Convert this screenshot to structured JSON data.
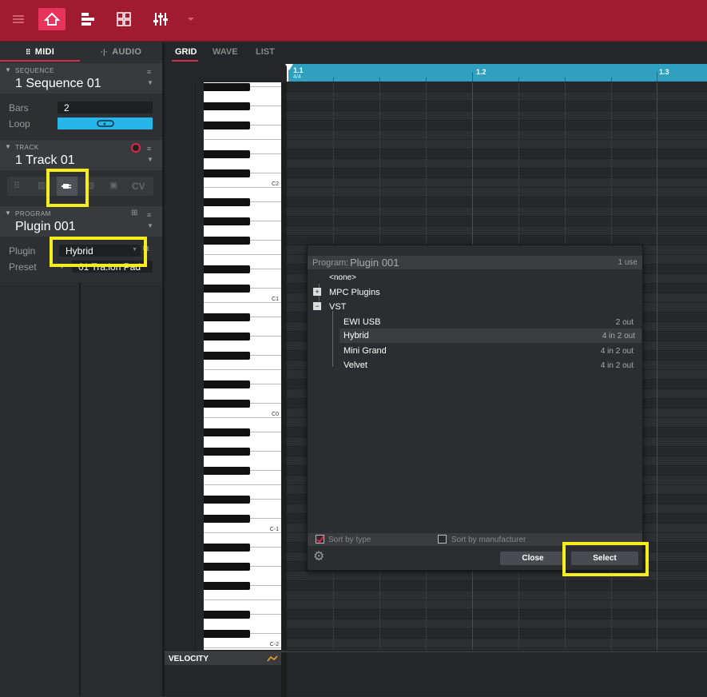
{
  "topbar": {
    "icons": [
      "menu-icon",
      "home-icon",
      "sequence-icon",
      "pads-icon",
      "mixer-icon",
      "dropdown-icon"
    ],
    "bg_color": "#a01a30",
    "active_color": "#e6345a"
  },
  "mode_tabs": {
    "midi": "MIDI",
    "audio": "AUDIO"
  },
  "sequence": {
    "label": "SEQUENCE",
    "title": "1 Sequence 01",
    "bars_label": "Bars",
    "bars_value": "2",
    "loop_label": "Loop"
  },
  "track": {
    "label": "TRACK",
    "title": "1 Track 01",
    "type_cv": "CV"
  },
  "program": {
    "label": "PROGRAM",
    "title": "Plugin 001",
    "plugin_label": "Plugin",
    "plugin_value": "Hybrid",
    "preset_label": "Preset",
    "preset_value": "01 Tra.ion Pad"
  },
  "view_tabs": {
    "grid": "GRID",
    "wave": "WAVE",
    "list": "LIST"
  },
  "ruler": {
    "m1": "1.1",
    "sig": "4/4",
    "m2": "1.2",
    "m3": "1.3",
    "color": "#2fa0bf"
  },
  "keys": {
    "c2": "C2",
    "c1": "C1",
    "c0": "C0",
    "cm1": "C-1",
    "cm2": "C-2"
  },
  "velocity": {
    "label": "VELOCITY"
  },
  "dialog": {
    "prefix": "Program:",
    "program_name": "Plugin 001",
    "uses": "1 use",
    "none": "<none>",
    "mpc_plugins": "MPC Plugins",
    "vst": "VST",
    "items": [
      {
        "name": "EWI USB",
        "io": "2 out"
      },
      {
        "name": "Hybrid",
        "io": "4 in 2 out"
      },
      {
        "name": "Mini Grand",
        "io": "4 in 2 out"
      },
      {
        "name": "Velvet",
        "io": "4 in 2 out"
      }
    ],
    "sort_by_type": "Sort by type",
    "sort_by_manufacturer": "Sort by manufacturer",
    "close": "Close",
    "select": "Select"
  },
  "highlight_color": "#f5ee1c"
}
